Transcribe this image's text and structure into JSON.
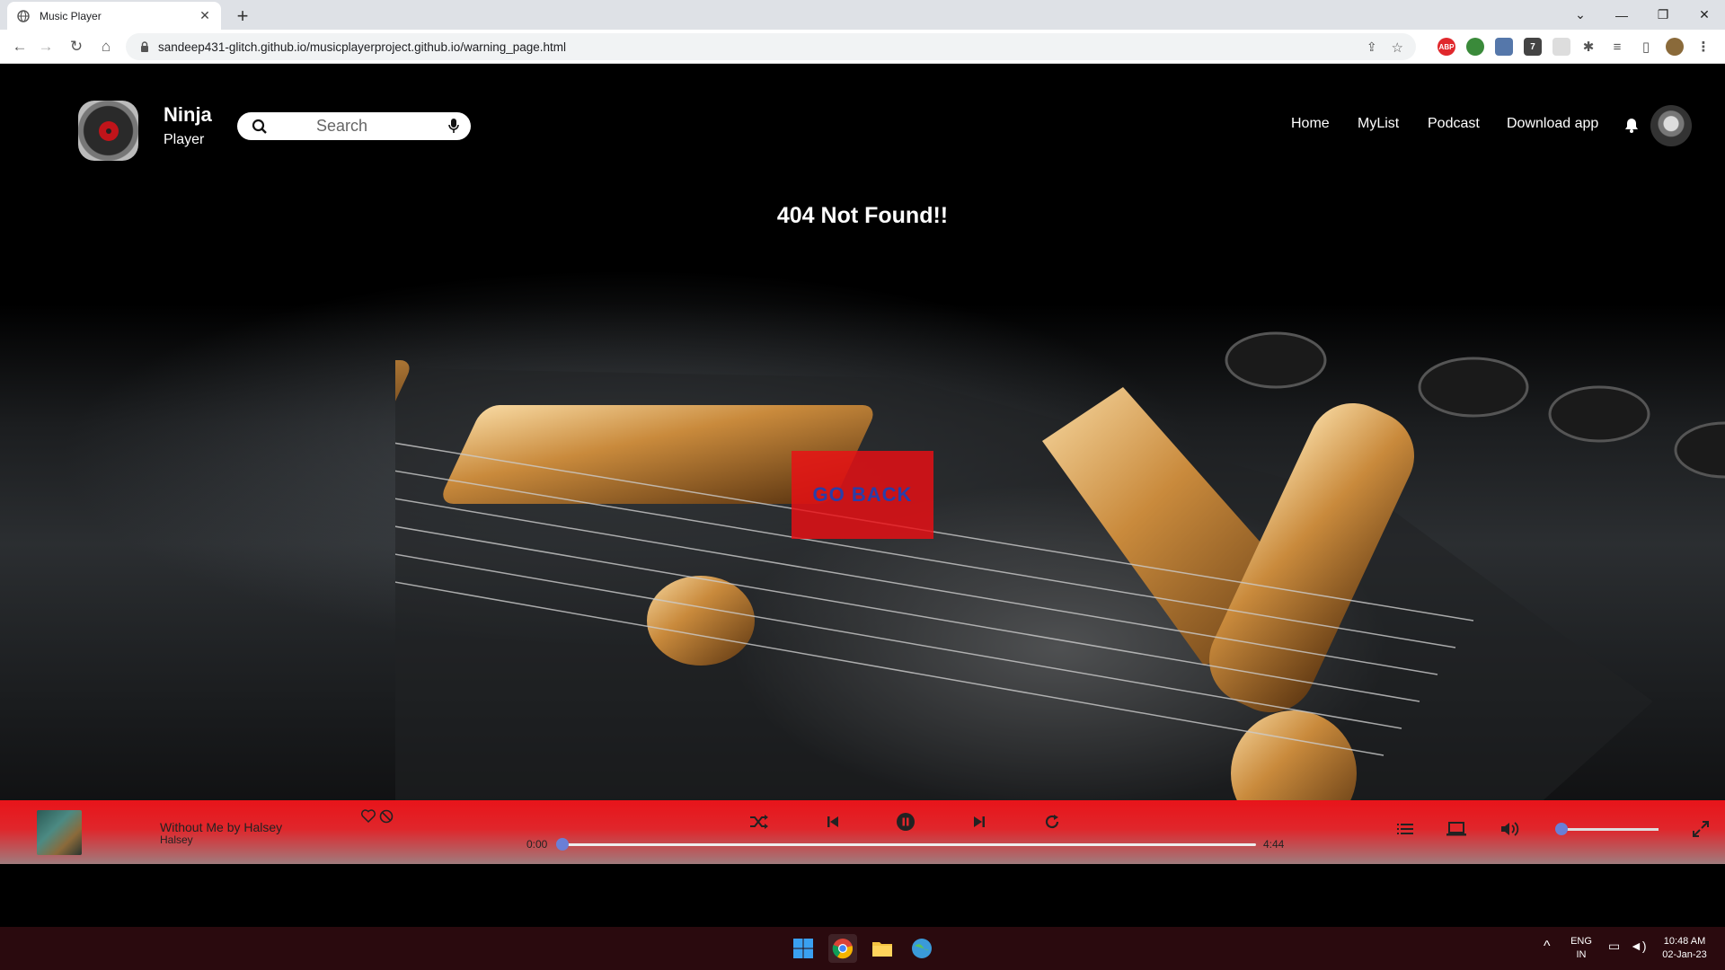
{
  "browser": {
    "tab_title": "Music Player",
    "url": "sandeep431-glitch.github.io/musicplayerproject.github.io/warning_page.html",
    "extension_badge": "7"
  },
  "header": {
    "brand_name": "Ninja",
    "brand_sub": "Player",
    "search_placeholder": "Search",
    "nav": [
      "Home",
      "MyList",
      "Podcast",
      "Download app"
    ]
  },
  "main": {
    "error_title": "404 Not Found!!",
    "go_back_label": "GO BACK"
  },
  "player": {
    "song_title": "Without Me by Halsey",
    "artist": "Halsey",
    "current_time": "0:00",
    "duration": "4:44",
    "progress": 0,
    "volume": 0
  },
  "taskbar": {
    "lang_line1": "ENG",
    "lang_line2": "IN",
    "time": "10:48 AM",
    "date": "02-Jan-23"
  },
  "colors": {
    "player_red": "#e8141a",
    "button_red": "#eb0f14",
    "go_back_text": "#2a3ea8",
    "thumb_blue": "#6a7fd6"
  }
}
